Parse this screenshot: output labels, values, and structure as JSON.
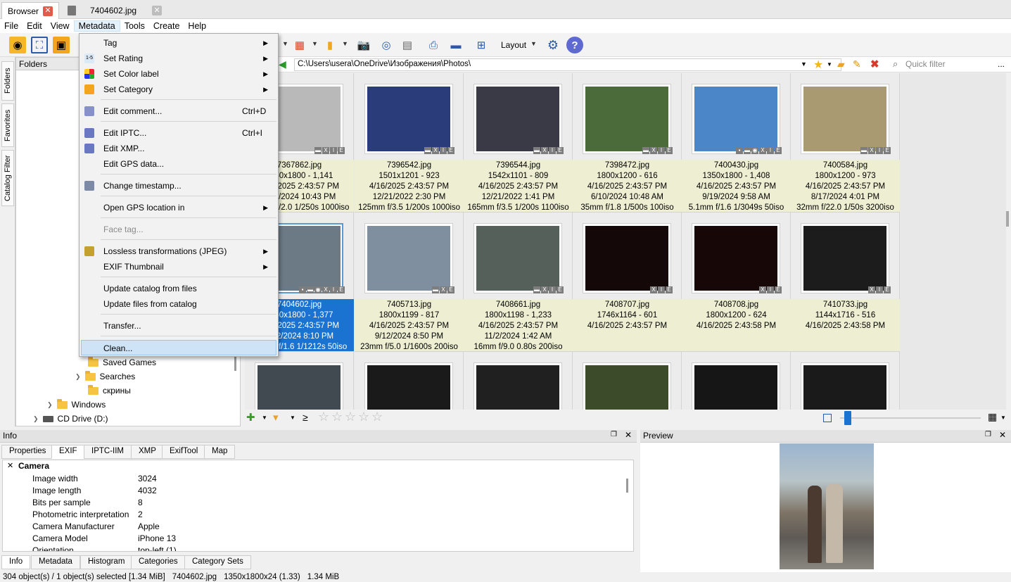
{
  "tabs": {
    "browser": "Browser",
    "image": "7404602.jpg"
  },
  "menubar": [
    "File",
    "Edit",
    "View",
    "Metadata",
    "Tools",
    "Create",
    "Help"
  ],
  "toolbar": {
    "layout": "Layout"
  },
  "sidetabs": [
    "Folders",
    "Favorites",
    "Catalog Filter"
  ],
  "folders": {
    "header": "Folders",
    "items": [
      "Saved Games",
      "Searches",
      "скрины",
      "Windows",
      "CD Drive (D:)"
    ]
  },
  "path": {
    "value": "C:\\Users\\usera\\OneDrive\\Изображения\\Photos\\",
    "filter_placeholder": "Quick filter",
    "more": "..."
  },
  "menu": {
    "tag": "Tag",
    "set_rating": "Set Rating",
    "set_color_label": "Set Color label",
    "set_category": "Set Category",
    "edit_comment": "Edit comment...",
    "edit_comment_shortcut": "Ctrl+D",
    "edit_iptc": "Edit IPTC...",
    "edit_iptc_shortcut": "Ctrl+I",
    "edit_xmp": "Edit XMP...",
    "edit_gps": "Edit GPS data...",
    "change_timestamp": "Change timestamp...",
    "open_gps": "Open GPS location in",
    "face_tag": "Face tag...",
    "lossless": "Lossless transformations (JPEG)",
    "exif_thumb": "EXIF Thumbnail",
    "update_catalog": "Update catalog from files",
    "update_files": "Update files from catalog",
    "transfer": "Transfer...",
    "clean": "Clean..."
  },
  "grid": [
    {
      "name": "7367862.jpg",
      "l2": "1350x1800 - 1,141",
      "l3": "4/16/2025 2:43:57 PM",
      "l4": "9/19/2024 10:43 PM",
      "l5": "4.2mm f/2.0 1/250s 1000iso",
      "color": "#b9b9b9",
      "badges": [
        "▬",
        "X",
        "I",
        "E"
      ]
    },
    {
      "name": "7396542.jpg",
      "l2": "1501x1201 - 923",
      "l3": "4/16/2025 2:43:57 PM",
      "l4": "12/21/2022 2:30 PM",
      "l5": "125mm f/3.5 1/200s 1000iso",
      "color": "#2a3d7a",
      "badges": [
        "▬",
        "X",
        "I",
        "E"
      ]
    },
    {
      "name": "7396544.jpg",
      "l2": "1542x1101 - 809",
      "l3": "4/16/2025 2:43:57 PM",
      "l4": "12/21/2022 1:41 PM",
      "l5": "165mm f/3.5 1/200s 1100iso",
      "color": "#3a3a46",
      "badges": [
        "▬",
        "X",
        "I",
        "E"
      ]
    },
    {
      "name": "7398472.jpg",
      "l2": "1800x1200 - 616",
      "l3": "4/16/2025 2:43:57 PM",
      "l4": "6/10/2024 10:48 AM",
      "l5": "35mm f/1.8 1/500s 100iso",
      "color": "#4b6b3a",
      "badges": [
        "▬",
        "X",
        "I",
        "E"
      ]
    },
    {
      "name": "7400430.jpg",
      "l2": "1350x1800 - 1,408",
      "l3": "4/16/2025 2:43:57 PM",
      "l4": "9/19/2024 9:58 AM",
      "l5": "5.1mm f/1.6 1/3049s 50iso",
      "color": "#4a86c8",
      "badges": [
        "▪",
        "▬",
        "◉",
        "X",
        "I",
        "E"
      ]
    },
    {
      "name": "7400584.jpg",
      "l2": "1800x1200 - 973",
      "l3": "4/16/2025 2:43:57 PM",
      "l4": "8/17/2024 4:01 PM",
      "l5": "32mm f/22.0 1/50s 3200iso",
      "color": "#a99a72",
      "badges": [
        "▬",
        "X",
        "I",
        "E"
      ]
    },
    {
      "name": "7404602.jpg",
      "l2": "1350x1800 - 1,377",
      "l3": "4/16/2025 2:43:57 PM",
      "l4": "9/12/2024 8:10 PM",
      "l5": "5.1mm f/1.6 1/1212s 50iso",
      "color": "#6c7a86",
      "badges": [
        "▪",
        "▬",
        "◉",
        "X",
        "I",
        "E"
      ],
      "selected": true
    },
    {
      "name": "7405713.jpg",
      "l2": "1800x1199 - 817",
      "l3": "4/16/2025 2:43:57 PM",
      "l4": "9/12/2024 8:50 PM",
      "l5": "23mm f/5.0 1/1600s 200iso",
      "color": "#7f8fa0",
      "badges": [
        "▬",
        "X",
        "E"
      ]
    },
    {
      "name": "7408661.jpg",
      "l2": "1800x1198 - 1,233",
      "l3": "4/16/2025 2:43:57 PM",
      "l4": "11/2/2024 1:42 AM",
      "l5": "16mm f/9.0 0.80s 200iso",
      "color": "#55605a",
      "badges": [
        "▬",
        "X",
        "I",
        "E"
      ]
    },
    {
      "name": "7408707.jpg",
      "l2": "1746x1164 - 601",
      "l3": "4/16/2025 2:43:57 PM",
      "l4": "",
      "l5": "",
      "color": "#140808",
      "badges": [
        "X",
        "I",
        "E"
      ]
    },
    {
      "name": "7408708.jpg",
      "l2": "1800x1200 - 624",
      "l3": "4/16/2025 2:43:58 PM",
      "l4": "",
      "l5": "",
      "color": "#180707",
      "badges": [
        "X",
        "I",
        "E"
      ]
    },
    {
      "name": "7410733.jpg",
      "l2": "1144x1716 - 516",
      "l3": "4/16/2025 2:43:58 PM",
      "l4": "",
      "l5": "",
      "color": "#1c1c1c",
      "badges": [
        "X",
        "I",
        "E"
      ]
    },
    {
      "name": "",
      "l2": "",
      "l3": "",
      "l4": "",
      "l5": "",
      "color": "#404a50",
      "badges": []
    },
    {
      "name": "",
      "l2": "",
      "l3": "",
      "l4": "",
      "l5": "",
      "color": "#1a1a1a",
      "badges": []
    },
    {
      "name": "",
      "l2": "",
      "l3": "",
      "l4": "",
      "l5": "",
      "color": "#202020",
      "badges": []
    },
    {
      "name": "",
      "l2": "",
      "l3": "",
      "l4": "",
      "l5": "",
      "color": "#3c4c2a",
      "badges": []
    },
    {
      "name": "",
      "l2": "",
      "l3": "",
      "l4": "",
      "l5": "",
      "color": "#161616",
      "badges": []
    },
    {
      "name": "",
      "l2": "",
      "l3": "",
      "l4": "",
      "l5": "",
      "color": "#1a1a1a",
      "badges": []
    }
  ],
  "ratingbar": {
    "gte": "≥"
  },
  "infopanel": {
    "title": "Info",
    "tabs": [
      "Properties",
      "EXIF",
      "IPTC-IIM",
      "XMP",
      "ExifTool",
      "Map"
    ],
    "section": "Camera",
    "rows": [
      [
        "Image width",
        "3024"
      ],
      [
        "Image length",
        "4032"
      ],
      [
        "Bits per sample",
        "8"
      ],
      [
        "Photometric interpretation",
        "2"
      ],
      [
        "Camera Manufacturer",
        "Apple"
      ],
      [
        "Camera Model",
        "iPhone 13"
      ],
      [
        "Orientation",
        "top-left (1)"
      ]
    ],
    "bottom_tabs": [
      "Info",
      "Metadata",
      "Histogram",
      "Categories",
      "Category Sets"
    ]
  },
  "preview": {
    "title": "Preview"
  },
  "status": [
    "304 object(s) / 1 object(s) selected [1.34 MiB]",
    "7404602.jpg",
    "1350x1800x24 (1.33)",
    "1.34 MiB"
  ]
}
